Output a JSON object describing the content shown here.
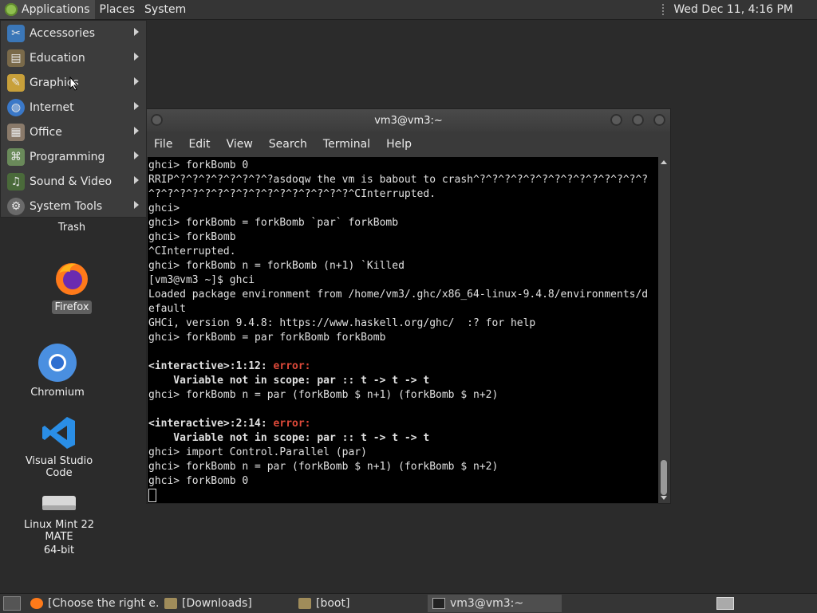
{
  "top_panel": {
    "menus": [
      "Applications",
      "Places",
      "System"
    ],
    "clock": "Wed Dec 11,  4:16 PM"
  },
  "app_menu": {
    "items": [
      {
        "label": "Accessories",
        "icon": "accessories-icon"
      },
      {
        "label": "Education",
        "icon": "education-icon"
      },
      {
        "label": "Graphics",
        "icon": "graphics-icon"
      },
      {
        "label": "Internet",
        "icon": "internet-icon"
      },
      {
        "label": "Office",
        "icon": "office-icon"
      },
      {
        "label": "Programming",
        "icon": "programming-icon"
      },
      {
        "label": "Sound & Video",
        "icon": "sound-video-icon"
      },
      {
        "label": "System Tools",
        "icon": "system-tools-icon"
      }
    ]
  },
  "desktop": {
    "icons": [
      {
        "label": "Trash"
      },
      {
        "label": "Firefox"
      },
      {
        "label": "Chromium"
      },
      {
        "label": "Visual Studio Code"
      },
      {
        "label": "Linux Mint 22 MATE"
      },
      {
        "label": "64-bit"
      }
    ]
  },
  "terminal": {
    "title": "vm3@vm3:~",
    "menus": [
      "File",
      "Edit",
      "View",
      "Search",
      "Terminal",
      "Help"
    ],
    "lines": [
      "ghci> forkBomb 0",
      "RRIP^?^?^?^?^?^?^?^?asdoqw the vm is babout to crash^?^?^?^?^?^?^?^?^?^?^?^?^?^?",
      "^?^?^?^?^?^?^?^?^?^?^?^?^?^?^?^?^CInterrupted.",
      "ghci>",
      "ghci> forkBomb = forkBomb `par` forkBomb",
      "ghci> forkBomb",
      "^CInterrupted.",
      "ghci> forkBomb n = forkBomb (n+1) `Killed",
      "[vm3@vm3 ~]$ ghci",
      "Loaded package environment from /home/vm3/.ghc/x86_64-linux-9.4.8/environments/d",
      "efault",
      "GHCi, version 9.4.8: https://www.haskell.org/ghc/  :? for help",
      "ghci> forkBomb = par forkBomb forkBomb",
      "",
      "",
      "    Variable not in scope: par :: t -> t -> t",
      "ghci> forkBomb n = par (forkBomb $ n+1) (forkBomb $ n+2)",
      "",
      "",
      "    Variable not in scope: par :: t -> t -> t",
      "ghci> import Control.Parallel (par)",
      "ghci> forkBomb n = par (forkBomb $ n+1) (forkBomb $ n+2)",
      "ghci> forkBomb 0"
    ],
    "error1": {
      "loc": "<interactive>:1:12: ",
      "word": "error:"
    },
    "error2": {
      "loc": "<interactive>:2:14: ",
      "word": "error:"
    }
  },
  "bottom_panel": {
    "tasks": [
      {
        "label": "[Choose the right e...",
        "icon": "firefox-icon"
      },
      {
        "label": "[Downloads]",
        "icon": "folder-icon"
      },
      {
        "label": "[boot]",
        "icon": "folder-icon"
      },
      {
        "label": "vm3@vm3:~",
        "icon": "terminal-icon"
      }
    ]
  }
}
